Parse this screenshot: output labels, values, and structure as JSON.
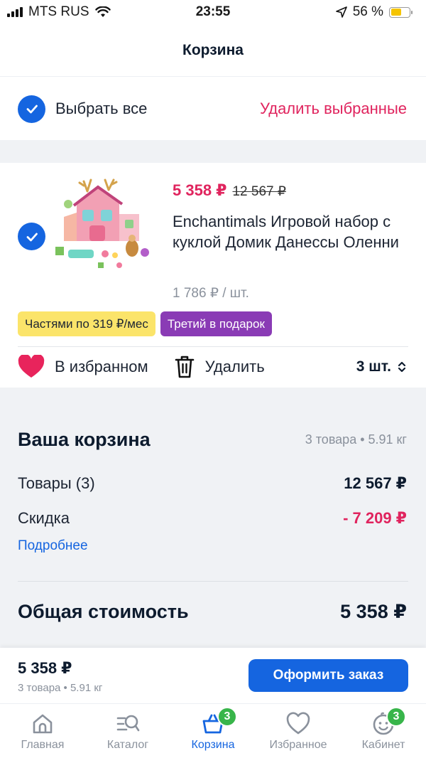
{
  "status_bar": {
    "carrier": "MTS RUS",
    "time": "23:55",
    "battery": "56 %",
    "battery_level": 0.56
  },
  "header": {
    "title": "Корзина"
  },
  "selection": {
    "select_all": "Выбрать все",
    "delete_selected": "Удалить выбранные"
  },
  "product": {
    "price_new": "5 358 ₽",
    "price_old": "12 567 ₽",
    "title": "Enchantimals Игровой набор с куклой Домик Данессы Оленни",
    "unit_price": "1 786 ₽ / шт.",
    "badge_installment": "Частями по 319 ₽/мес",
    "badge_promo": "Третий в подарок",
    "favorite_label": "В избранном",
    "delete_label": "Удалить",
    "quantity": "3 шт."
  },
  "summary": {
    "title": "Ваша корзина",
    "meta": "3 товара • 5.91 кг",
    "items_label": "Товары (3)",
    "items_value": "12 567 ₽",
    "discount_label": "Скидка",
    "discount_value": "- 7 209 ₽",
    "details_link": "Подробнее",
    "total_label": "Общая стоимость",
    "total_value": "5 358 ₽"
  },
  "checkout": {
    "price": "5 358 ₽",
    "meta": "3 товара • 5.91 кг",
    "button": "Оформить заказ"
  },
  "tabbar": {
    "items": [
      {
        "label": "Главная",
        "icon": "home-icon"
      },
      {
        "label": "Каталог",
        "icon": "catalog-search-icon"
      },
      {
        "label": "Корзина",
        "icon": "basket-icon",
        "badge": "3",
        "active": true
      },
      {
        "label": "Избранное",
        "icon": "heart-icon"
      },
      {
        "label": "Кабинет",
        "icon": "smile-icon",
        "badge": "3"
      }
    ]
  },
  "colors": {
    "accent": "#1565e0",
    "sale": "#e0245e",
    "badge_green": "#38b54a",
    "promo_purple": "#8a3bb5",
    "installment_yellow": "#fbe46a"
  }
}
